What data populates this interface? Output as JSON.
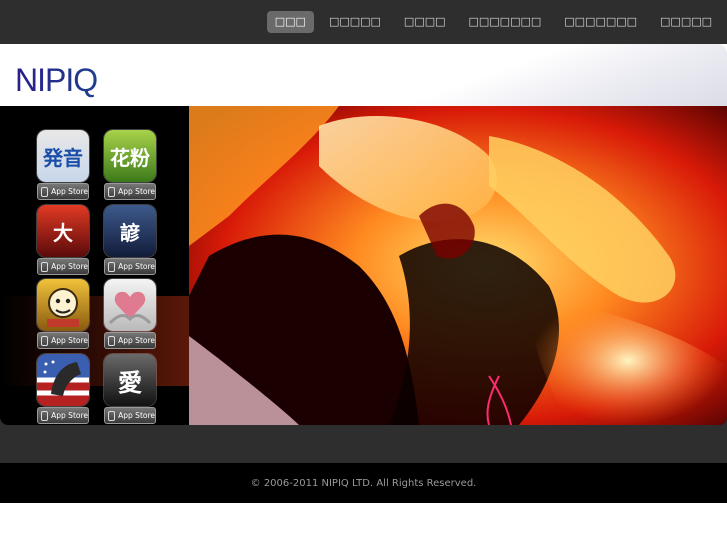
{
  "nav": {
    "items": [
      {
        "label": "□□□",
        "active": true
      },
      {
        "label": "□□□□□",
        "active": false
      },
      {
        "label": "□□□□",
        "active": false
      },
      {
        "label": "□□□□□□□",
        "active": false
      },
      {
        "label": "□□□□□□□",
        "active": false
      },
      {
        "label": "□□□□□",
        "active": false
      }
    ]
  },
  "header": {
    "logo_text": "NIPIQ"
  },
  "apps": {
    "badge_label": "App Store",
    "items": [
      {
        "glyph": "発音",
        "color_top": "#e8e8e8",
        "color_bottom": "#c8d6ea",
        "text_color": "#1a4ea8"
      },
      {
        "glyph": "花粉",
        "color_top": "#a8d24a",
        "color_bottom": "#3c7a1a",
        "text_color": "#ffffff"
      },
      {
        "glyph": "大",
        "color_top": "#e23a24",
        "color_bottom": "#5a0a0a",
        "text_color": "#ffffff"
      },
      {
        "glyph": "諺",
        "color_top": "#3d5a8c",
        "color_bottom": "#121c3a",
        "text_color": "#ffffff"
      },
      {
        "glyph": "",
        "color_top": "#f0c23a",
        "color_bottom": "#8a5a10",
        "text_color": "#ffffff"
      },
      {
        "glyph": "",
        "color_top": "#f4f4f4",
        "color_bottom": "#b9b9b9",
        "text_color": "#d0405a"
      },
      {
        "glyph": "",
        "color_top": "#3b5fb0",
        "color_bottom": "#b52020",
        "text_color": "#ffffff"
      },
      {
        "glyph": "愛",
        "color_top": "#6a6a6a",
        "color_bottom": "#111111",
        "text_color": "#ffffff"
      }
    ]
  },
  "footer": {
    "copyright": "© 2006-2011 NIPIQ LTD. All Rights Reserved."
  }
}
